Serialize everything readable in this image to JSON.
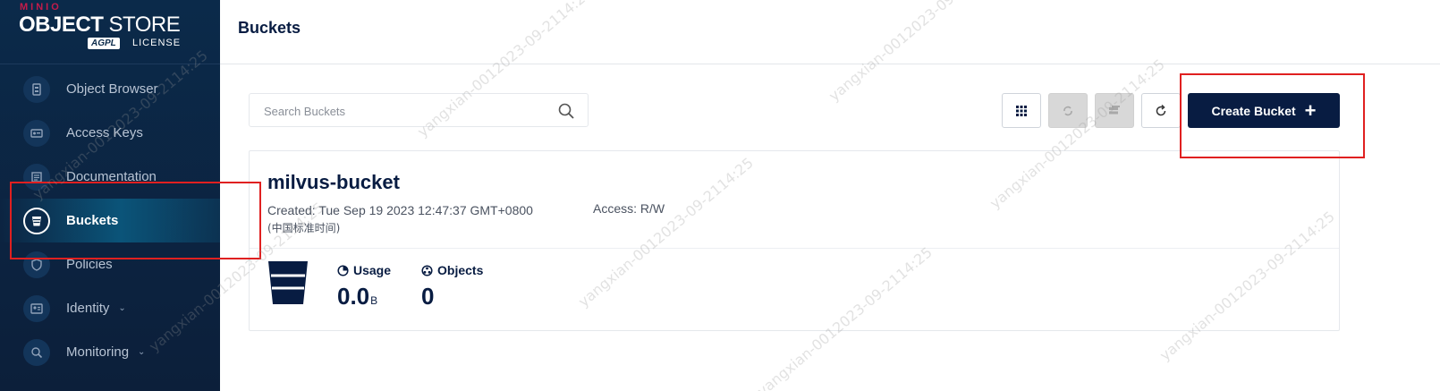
{
  "brand": {
    "minio": "MINIO",
    "store_bold": "OBJECT",
    "store_thin": "STORE",
    "badge": "AGPL",
    "license": "LICENSE"
  },
  "sidebar": {
    "items": [
      {
        "label": "Object Browser",
        "icon": "object-browser-icon",
        "active": false
      },
      {
        "label": "Access Keys",
        "icon": "access-keys-icon",
        "active": false
      },
      {
        "label": "Documentation",
        "icon": "documentation-icon",
        "active": false
      },
      {
        "label": "Buckets",
        "icon": "bucket-icon",
        "active": true
      },
      {
        "label": "Policies",
        "icon": "shield-icon",
        "active": false
      },
      {
        "label": "Identity",
        "icon": "identity-icon",
        "active": false,
        "expandable": true
      },
      {
        "label": "Monitoring",
        "icon": "monitoring-icon",
        "active": false,
        "expandable": true
      }
    ]
  },
  "header": {
    "title": "Buckets"
  },
  "toolbar": {
    "search_placeholder": "Search Buckets",
    "create_label": "Create Bucket"
  },
  "bucket": {
    "name": "milvus-bucket",
    "created": "Created: Tue Sep 19 2023 12:47:37 GMT+0800",
    "created_tz": "(中国标准时间)",
    "access": "Access: R/W",
    "usage_label": "Usage",
    "usage_value": "0.0",
    "usage_unit": "B",
    "objects_label": "Objects",
    "objects_value": "0"
  },
  "watermark": "yangxian-0012023-09-2114:25",
  "colors": {
    "sidebar": "#0c2340",
    "primary": "#081c42",
    "highlight": "#e02020"
  }
}
